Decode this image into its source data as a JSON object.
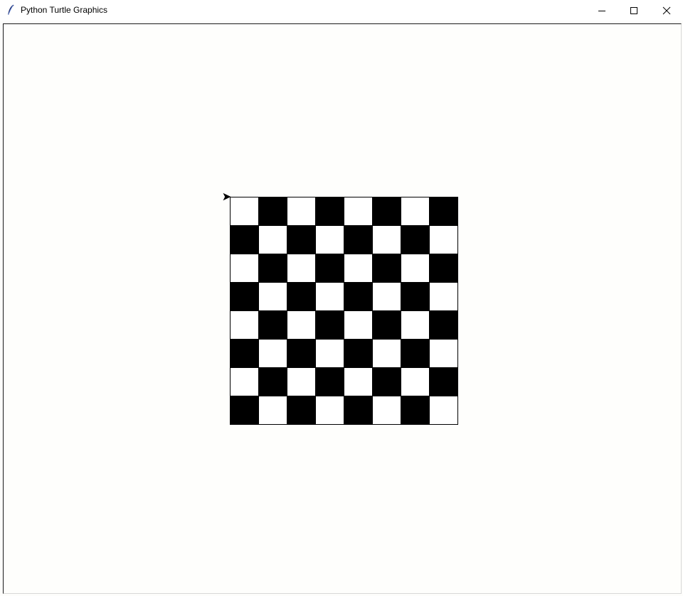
{
  "window": {
    "title": "Python Turtle Graphics",
    "icon": "feather-icon",
    "controls": {
      "minimize": "minimize-icon",
      "maximize": "maximize-icon",
      "close": "close-icon"
    }
  },
  "board": {
    "rows": 8,
    "cols": 8,
    "top_left_color": "white",
    "colors": {
      "dark": "#000000",
      "light": "#ffffff",
      "outline": "#000000"
    }
  },
  "turtle": {
    "shape": "arrow",
    "heading": "east",
    "color": "#000000"
  }
}
